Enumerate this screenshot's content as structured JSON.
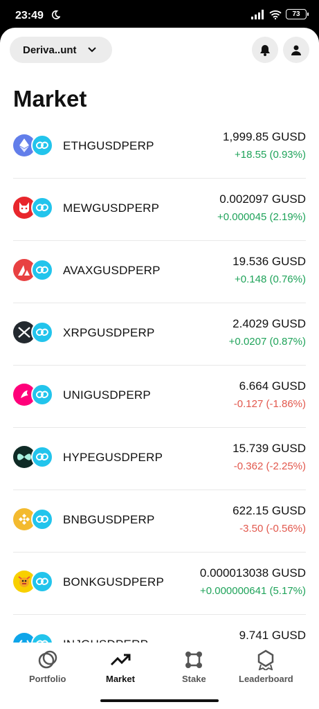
{
  "status_bar": {
    "time": "23:49",
    "battery": "73"
  },
  "header": {
    "account_label": "Deriva..unt",
    "page_title": "Market"
  },
  "markets": [
    {
      "symbol": "ETHGUSDPERP",
      "price": "1,999.85 GUSD",
      "change": "+18.55 (0.93%)",
      "direction": "up",
      "icon": "eth-icon",
      "color": "#627eea"
    },
    {
      "symbol": "MEWGUSDPERP",
      "price": "0.002097 GUSD",
      "change": "+0.000045 (2.19%)",
      "direction": "up",
      "icon": "mew-cat-icon",
      "color": "#e8262c"
    },
    {
      "symbol": "AVAXGUSDPERP",
      "price": "19.536 GUSD",
      "change": "+0.148 (0.76%)",
      "direction": "up",
      "icon": "avax-icon",
      "color": "#e84142"
    },
    {
      "symbol": "XRPGUSDPERP",
      "price": "2.4029 GUSD",
      "change": "+0.0207 (0.87%)",
      "direction": "up",
      "icon": "xrp-icon",
      "color": "#23292f"
    },
    {
      "symbol": "UNIGUSDPERP",
      "price": "6.664 GUSD",
      "change": "-0.127 (-1.86%)",
      "direction": "down",
      "icon": "uni-icon",
      "color": "#ff007a"
    },
    {
      "symbol": "HYPEGUSDPERP",
      "price": "15.739 GUSD",
      "change": "-0.362 (-2.25%)",
      "direction": "down",
      "icon": "hype-icon",
      "color": "#0f2b26"
    },
    {
      "symbol": "BNBGUSDPERP",
      "price": "622.15 GUSD",
      "change": "-3.50 (-0.56%)",
      "direction": "down",
      "icon": "bnb-icon",
      "color": "#f3ba2f"
    },
    {
      "symbol": "BONKGUSDPERP",
      "price": "0.000013038 GUSD",
      "change": "+0.000000641 (5.17%)",
      "direction": "up",
      "icon": "bonk-icon",
      "color": "#f8d000"
    },
    {
      "symbol": "INJGUSDPERP",
      "price": "9.741 GUSD",
      "change": "",
      "direction": "up",
      "icon": "inj-icon",
      "color": "#0ea5e9"
    }
  ],
  "nav": {
    "items": [
      {
        "label": "Portfolio",
        "icon": "portfolio-icon"
      },
      {
        "label": "Market",
        "icon": "market-trend-icon",
        "active": true
      },
      {
        "label": "Stake",
        "icon": "stake-icon"
      },
      {
        "label": "Leaderboard",
        "icon": "leaderboard-icon"
      }
    ]
  }
}
